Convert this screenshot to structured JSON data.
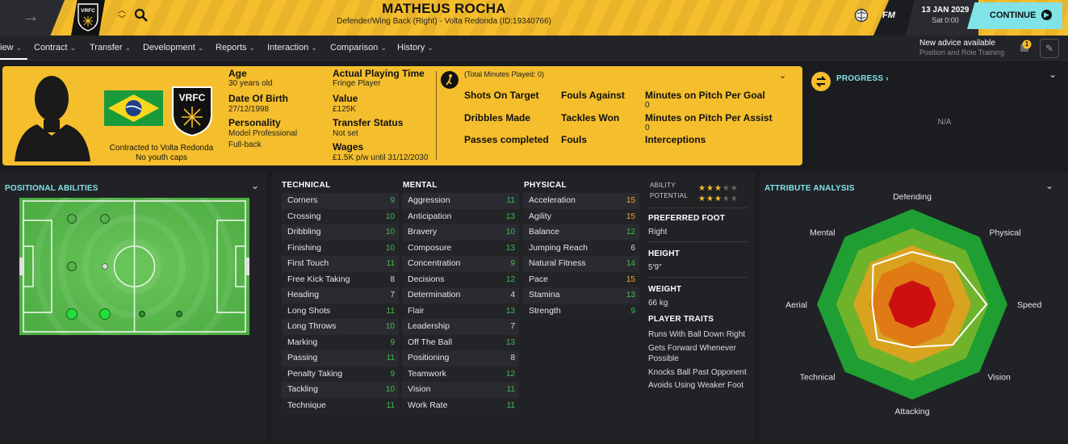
{
  "header": {
    "player_name": "MATHEUS ROCHA",
    "player_subtitle": "Defender/Wing Back (Right) - Volta Redonda (ID:19340766)",
    "club_badge_text": "VRFC",
    "fm_label": "FM",
    "date": "13 JAN 2029",
    "time": "Sat 0:00",
    "continue_label": "CONTINUE"
  },
  "nav": {
    "tabs": [
      "iew",
      "Contract",
      "Transfer",
      "Development",
      "Reports",
      "Interaction",
      "Comparison",
      "History"
    ],
    "advice_title": "New advice available",
    "advice_sub": "Position and Role Training",
    "advice_count": "1"
  },
  "profile": {
    "age_label": "Age",
    "age_value": "30 years old",
    "dob_label": "Date Of Birth",
    "dob_value": "27/12/1998",
    "personality_label": "Personality",
    "personality_value": "Model Professional",
    "role_value": "Full-back",
    "apt_label": "Actual Playing Time",
    "apt_value": "Fringe Player",
    "value_label": "Value",
    "value_value": "£125K",
    "transfer_label": "Transfer Status",
    "transfer_value": "Not set",
    "wages_label": "Wages",
    "wages_value": "£1.5K p/w until 31/12/2030",
    "contract_line1": "Contracted to Volta Redonda",
    "contract_line2": "No youth caps",
    "badge_text": "VRFC"
  },
  "season_stats": {
    "minutes_note": "(Total Minutes Played: 0)",
    "col1": [
      "Shots On Target",
      "Dribbles Made",
      "Passes completed"
    ],
    "col2": [
      "Fouls Against",
      "Tackles Won",
      "Fouls"
    ],
    "col3": [
      {
        "label": "Minutes on Pitch Per Goal",
        "value": "0"
      },
      {
        "label": "Minutes on Pitch Per Assist",
        "value": "0"
      },
      {
        "label": "Interceptions",
        "value": ""
      }
    ]
  },
  "progress": {
    "title": "PROGRESS",
    "na": "N/A"
  },
  "positional": {
    "title": "POSITIONAL ABILITIES"
  },
  "attributes": {
    "technical_title": "TECHNICAL",
    "mental_title": "MENTAL",
    "physical_title": "PHYSICAL",
    "technical": [
      {
        "name": "Corners",
        "value": "9"
      },
      {
        "name": "Crossing",
        "value": "10"
      },
      {
        "name": "Dribbling",
        "value": "10"
      },
      {
        "name": "Finishing",
        "value": "10"
      },
      {
        "name": "First Touch",
        "value": "11"
      },
      {
        "name": "Free Kick Taking",
        "value": "8"
      },
      {
        "name": "Heading",
        "value": "7"
      },
      {
        "name": "Long Shots",
        "value": "11"
      },
      {
        "name": "Long Throws",
        "value": "10"
      },
      {
        "name": "Marking",
        "value": "9"
      },
      {
        "name": "Passing",
        "value": "11"
      },
      {
        "name": "Penalty Taking",
        "value": "9"
      },
      {
        "name": "Tackling",
        "value": "10"
      },
      {
        "name": "Technique",
        "value": "11"
      }
    ],
    "mental": [
      {
        "name": "Aggression",
        "value": "11"
      },
      {
        "name": "Anticipation",
        "value": "13"
      },
      {
        "name": "Bravery",
        "value": "10"
      },
      {
        "name": "Composure",
        "value": "13"
      },
      {
        "name": "Concentration",
        "value": "9"
      },
      {
        "name": "Decisions",
        "value": "12"
      },
      {
        "name": "Determination",
        "value": "4"
      },
      {
        "name": "Flair",
        "value": "13"
      },
      {
        "name": "Leadership",
        "value": "7"
      },
      {
        "name": "Off The Ball",
        "value": "13"
      },
      {
        "name": "Positioning",
        "value": "8"
      },
      {
        "name": "Teamwork",
        "value": "12"
      },
      {
        "name": "Vision",
        "value": "11"
      },
      {
        "name": "Work Rate",
        "value": "11"
      }
    ],
    "physical": [
      {
        "name": "Acceleration",
        "value": "15"
      },
      {
        "name": "Agility",
        "value": "15"
      },
      {
        "name": "Balance",
        "value": "12"
      },
      {
        "name": "Jumping Reach",
        "value": "6"
      },
      {
        "name": "Natural Fitness",
        "value": "14"
      },
      {
        "name": "Pace",
        "value": "15"
      },
      {
        "name": "Stamina",
        "value": "13"
      },
      {
        "name": "Strength",
        "value": "9"
      }
    ]
  },
  "info": {
    "ability_label": "ABILITY",
    "ability_stars": 3,
    "potential_label": "POTENTIAL",
    "potential_stars": 3,
    "foot_label": "PREFERRED FOOT",
    "foot_value": "Right",
    "height_label": "HEIGHT",
    "height_value": "5'9\"",
    "weight_label": "WEIGHT",
    "weight_value": "66 kg",
    "traits_label": "PLAYER TRAITS",
    "traits": [
      "Runs With Ball Down Right",
      "Gets Forward Whenever Possible",
      "Knocks Ball Past Opponent",
      "Avoids Using Weaker Foot"
    ]
  },
  "analysis": {
    "title": "ATTRIBUTE ANALYSIS",
    "axes": [
      "Defending",
      "Physical",
      "Speed",
      "Vision",
      "Attacking",
      "Technical",
      "Aerial",
      "Mental"
    ],
    "values": [
      0.55,
      0.62,
      0.78,
      0.6,
      0.45,
      0.52,
      0.42,
      0.58
    ],
    "colors": {
      "green": "#1e9e33",
      "lime": "#6fb32a",
      "amber": "#d9a320",
      "orange": "#e07a14",
      "red": "#cc1010"
    }
  }
}
